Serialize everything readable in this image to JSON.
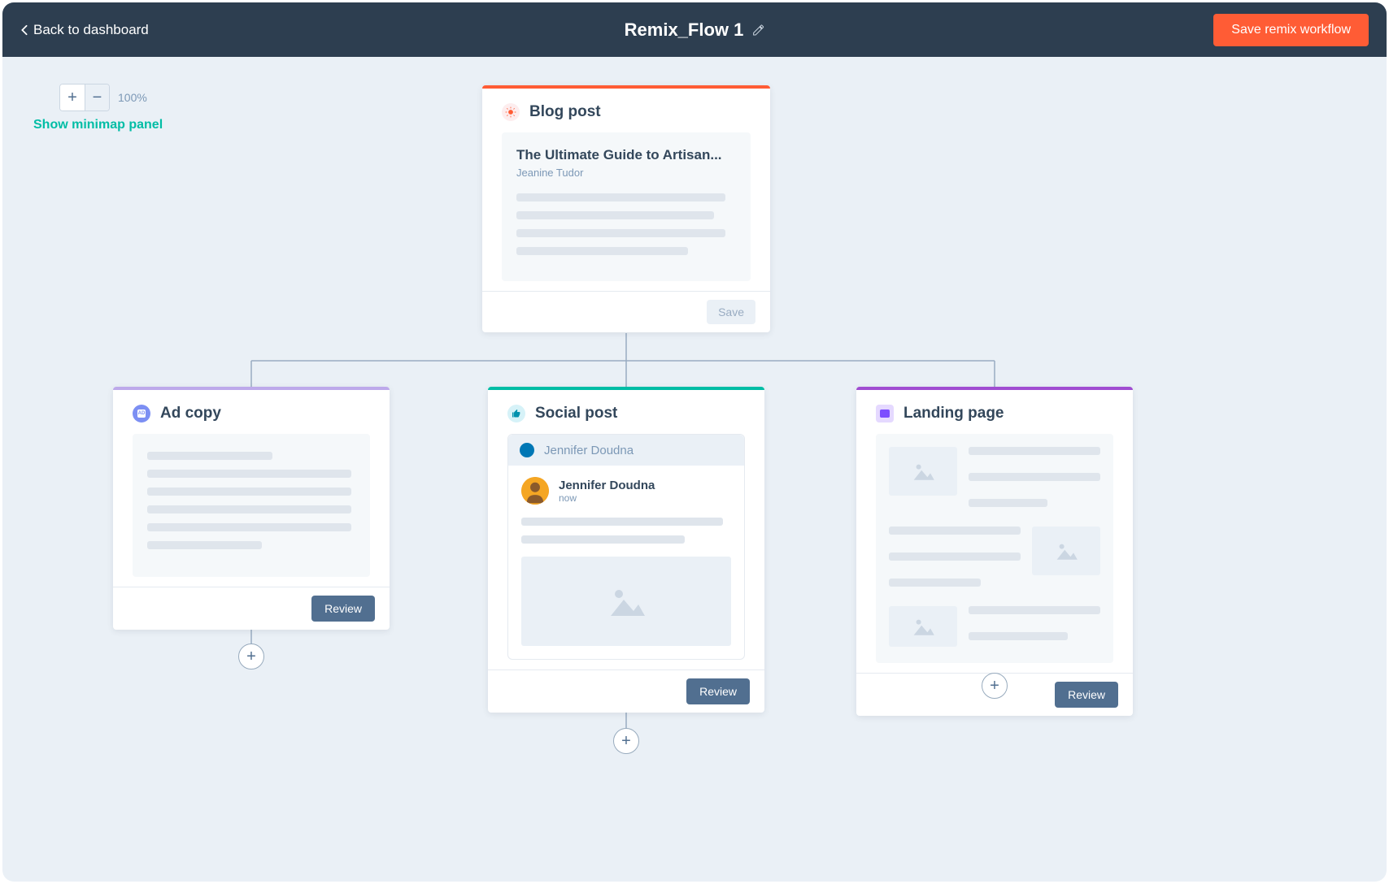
{
  "header": {
    "back": "Back to dashboard",
    "title": "Remix_Flow 1",
    "save": "Save remix workflow"
  },
  "zoom": {
    "label": "100%",
    "minimap": "Show minimap panel"
  },
  "cards": {
    "blog": {
      "title": "Blog post",
      "post_title": "The Ultimate Guide to Artisan...",
      "author": "Jeanine Tudor",
      "save": "Save"
    },
    "ad": {
      "title": "Ad copy",
      "review": "Review"
    },
    "social": {
      "title": "Social post",
      "account": "Jennifer Doudna",
      "user": "Jennifer Doudna",
      "time": "now",
      "review": "Review"
    },
    "landing": {
      "title": "Landing page",
      "review": "Review"
    }
  }
}
